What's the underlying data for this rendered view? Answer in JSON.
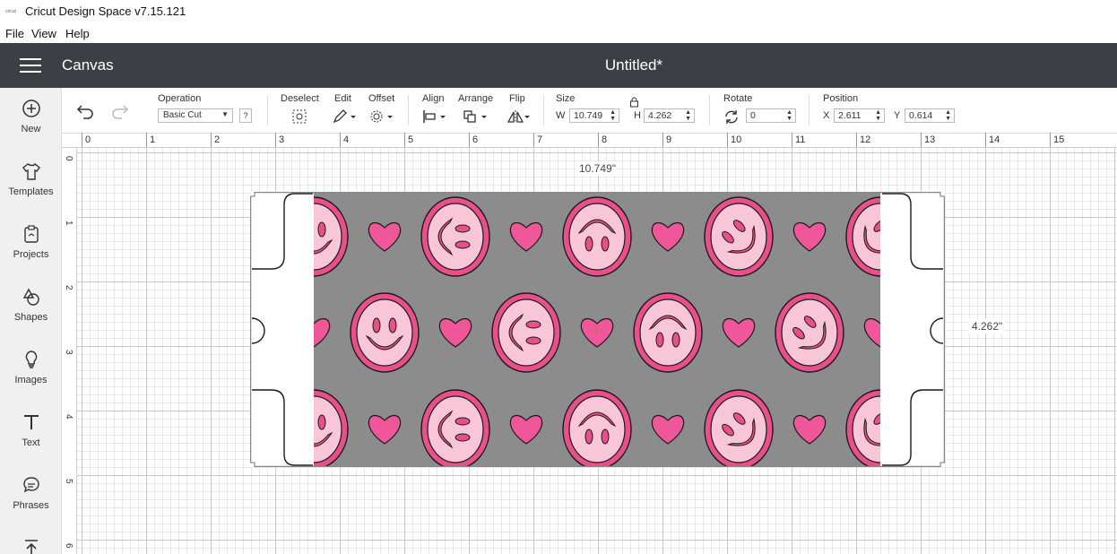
{
  "window": {
    "title": "Cricut Design Space  v7.15.121",
    "logo_text": "cricut"
  },
  "menu": [
    "File",
    "View",
    "Help"
  ],
  "header": {
    "section": "Canvas",
    "document_title": "Untitled*"
  },
  "sidebar": {
    "items": [
      {
        "label": "New",
        "icon": "plus-circle-icon"
      },
      {
        "label": "Templates",
        "icon": "shirt-icon"
      },
      {
        "label": "Projects",
        "icon": "clipboard-icon"
      },
      {
        "label": "Shapes",
        "icon": "shapes-icon"
      },
      {
        "label": "Images",
        "icon": "lightbulb-icon"
      },
      {
        "label": "Text",
        "icon": "text-t-icon"
      },
      {
        "label": "Phrases",
        "icon": "speech-bubble-icon"
      }
    ]
  },
  "toolbar": {
    "operation_label": "Operation",
    "operation_value": "Basic Cut",
    "help": "?",
    "deselect_label": "Deselect",
    "edit_label": "Edit",
    "offset_label": "Offset",
    "align_label": "Align",
    "arrange_label": "Arrange",
    "flip_label": "Flip",
    "size_label": "Size",
    "w_label": "W",
    "w_value": "10.749",
    "h_label": "H",
    "h_value": "4.262",
    "rotate_label": "Rotate",
    "rotate_value": "0",
    "position_label": "Position",
    "x_label": "X",
    "x_value": "2.611",
    "y_label": "Y",
    "y_value": "0.614"
  },
  "ruler": {
    "top": [
      "0",
      "1",
      "2",
      "3",
      "4",
      "5",
      "6",
      "7",
      "8",
      "9",
      "10",
      "11",
      "12",
      "13",
      "14",
      "15"
    ],
    "left": [
      "0",
      "1",
      "2",
      "3",
      "4",
      "5",
      "6"
    ]
  },
  "canvas": {
    "width_readout": "10.749\"",
    "height_readout": "4.262\"",
    "design_colors": {
      "background": "#8c8c8c",
      "face_outer": "#e94f8a",
      "face_inner": "#f8c6d6",
      "heart": "#f0569a",
      "ink": "#1a1a1a"
    }
  }
}
